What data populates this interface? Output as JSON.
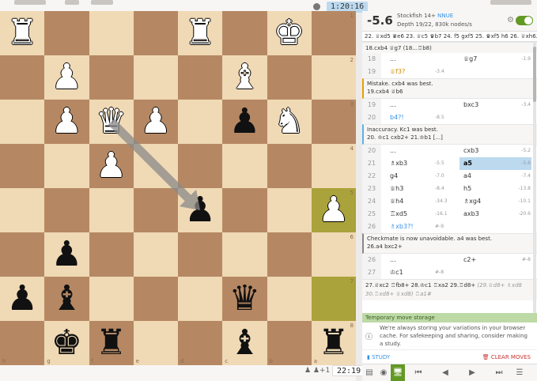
{
  "clocks": {
    "top": "1:20:16",
    "bottom": "22:19"
  },
  "board": {
    "files": [
      "h",
      "g",
      "f",
      "e",
      "d",
      "c",
      "b",
      "a"
    ],
    "ranks": [
      "1",
      "2",
      "3",
      "4",
      "5",
      "6",
      "7",
      "8"
    ],
    "highlight_squares": [
      "a5",
      "a7"
    ],
    "arrow": {
      "from": "f3",
      "to": "d5",
      "color": "#8a8a8a"
    },
    "pieces": [
      {
        "square": "h1",
        "symbol": "♜",
        "side": "white",
        "name": "white-rook"
      },
      {
        "square": "d1",
        "symbol": "♜",
        "side": "white",
        "name": "white-rook"
      },
      {
        "square": "b1",
        "symbol": "♚",
        "side": "white",
        "name": "white-king"
      },
      {
        "square": "g2",
        "symbol": "♟",
        "side": "white",
        "name": "white-pawn"
      },
      {
        "square": "c2",
        "symbol": "♝",
        "side": "white",
        "name": "white-bishop"
      },
      {
        "square": "g3",
        "symbol": "♟",
        "side": "white",
        "name": "white-pawn"
      },
      {
        "square": "f3",
        "symbol": "♛",
        "side": "white",
        "name": "white-queen"
      },
      {
        "square": "e3",
        "symbol": "♟",
        "side": "white",
        "name": "white-pawn"
      },
      {
        "square": "b3",
        "symbol": "♞",
        "side": "white",
        "name": "white-knight"
      },
      {
        "square": "f4",
        "symbol": "♟",
        "side": "white",
        "name": "white-pawn"
      },
      {
        "square": "a5",
        "symbol": "♟",
        "side": "white",
        "name": "white-pawn"
      },
      {
        "square": "c3",
        "symbol": "♟",
        "side": "black",
        "name": "black-pawn"
      },
      {
        "square": "d5",
        "symbol": "♟",
        "side": "black",
        "name": "black-pawn"
      },
      {
        "square": "g6",
        "symbol": "♟",
        "side": "black",
        "name": "black-pawn"
      },
      {
        "square": "h7",
        "symbol": "♟",
        "side": "black",
        "name": "black-pawn"
      },
      {
        "square": "g7",
        "symbol": "♝",
        "side": "black",
        "name": "black-bishop"
      },
      {
        "square": "c7",
        "symbol": "♛",
        "side": "black",
        "name": "black-queen"
      },
      {
        "square": "g8",
        "symbol": "♚",
        "side": "black",
        "name": "black-king"
      },
      {
        "square": "f8",
        "symbol": "♜",
        "side": "black",
        "name": "black-rook"
      },
      {
        "square": "c8",
        "symbol": "♝",
        "side": "black",
        "name": "black-bishop"
      },
      {
        "square": "a8",
        "symbol": "♜",
        "side": "black",
        "name": "black-rook"
      }
    ]
  },
  "below_board": {
    "icons": "♟ ♟+1"
  },
  "engine": {
    "eval": "-5.6",
    "name": "Stockfish 14+",
    "nnue": "NNUE",
    "depth": "Depth 19/22, 830k nodes/s",
    "gear_icon": "⚙",
    "pv": "22. ♕xd5 ♛e6 23. ♕c5 ♛b7 24. f5 gxf5 25. ♛xf5 h6 26. ♕xh6..."
  },
  "moves": {
    "top_variation": "18.cxb4 ♕g7 (18...♖b8)",
    "rows1": [
      {
        "num": "18",
        "white": "...",
        "white_eval": "",
        "black": "♕g7",
        "black_eval": "-1.9",
        "white_class": "",
        "black_class": ""
      },
      {
        "num": "19",
        "white": "♕f3?",
        "white_eval": "-3.4",
        "black": "",
        "black_eval": "",
        "white_class": "orange",
        "black_class": ""
      }
    ],
    "comment1": {
      "title": "Mistake. cxb4 was best.",
      "line": "19.cxb4 ♕b6"
    },
    "rows2": [
      {
        "num": "19",
        "white": "...",
        "white_eval": "",
        "black": "bxc3",
        "black_eval": "-3.4",
        "white_class": "",
        "black_class": ""
      },
      {
        "num": "20",
        "white": "b4?!",
        "white_eval": "-8.5",
        "black": "",
        "black_eval": "",
        "white_class": "blue",
        "black_class": ""
      }
    ],
    "comment2": {
      "title": "Inaccuracy. Kc1 was best.",
      "line": "20. ♔c1 cxb2+ 21.♔b1 [...]"
    },
    "rows3": [
      {
        "num": "20",
        "white": "...",
        "white_eval": "",
        "black": "cxb3",
        "black_eval": "-5.2",
        "white_class": "",
        "black_class": "",
        "current": false
      },
      {
        "num": "21",
        "white": "♗xb3",
        "white_eval": "-5.5",
        "black": "a5",
        "black_eval": "-5.6",
        "white_class": "",
        "black_class": "",
        "current": true
      },
      {
        "num": "22",
        "white": "g4",
        "white_eval": "-7.0",
        "black": "a4",
        "black_eval": "-7.4",
        "white_class": "",
        "black_class": "",
        "current": false
      },
      {
        "num": "23",
        "white": "♕h3",
        "white_eval": "-8.4",
        "black": "h5",
        "black_eval": "-13.8",
        "white_class": "",
        "black_class": "",
        "current": false
      },
      {
        "num": "24",
        "white": "♕h4",
        "white_eval": "-34.3",
        "black": "♗xg4",
        "black_eval": "-10.1",
        "white_class": "",
        "black_class": "",
        "current": false
      },
      {
        "num": "25",
        "white": "♖xd5",
        "white_eval": "-16.1",
        "black": "axb3",
        "black_eval": "-20.6",
        "white_class": "",
        "black_class": "",
        "current": false
      },
      {
        "num": "26",
        "white": "♗xb3?!",
        "white_eval": "#-9",
        "black": "",
        "black_eval": "",
        "white_class": "blue",
        "black_class": "",
        "current": false
      }
    ],
    "comment3": {
      "title": "Checkmate is now unavoidable. a4 was best.",
      "line": "26.a4 bxc2+"
    },
    "rows4": [
      {
        "num": "26",
        "white": "...",
        "white_eval": "",
        "black": "c2+",
        "black_eval": "#-8",
        "white_class": "",
        "black_class": ""
      },
      {
        "num": "27",
        "white": "♔c1",
        "white_eval": "#-8",
        "black": "",
        "black_eval": "",
        "white_class": "",
        "black_class": ""
      }
    ],
    "end_variation_main": "27.♕xc2 ♖fb8+ 28.♔c1 ♖xa2 29.♖d8+",
    "end_variation_dim": "(29.♕d8+ ♗xd8",
    "end_variation_2": "30.♖xd8+ ♕xd8) ♖a1#"
  },
  "tms": {
    "title": "Temporary move storage",
    "body": "We're always storing your variations in your browser cache. For safekeeping and sharing, consider making a study.",
    "study_label": "STUDY",
    "clear_label": "CLEAR MOVES"
  },
  "controls": {
    "icons": [
      "▤",
      "◉",
      "🖥",
      "⏮",
      "◀",
      "▶",
      "⏭",
      "☰"
    ]
  },
  "colors": {
    "light": "#f0d9b5",
    "dark": "#b58863",
    "highlight": "#aaa23a",
    "accent": "#629924",
    "blue": "#3692e7"
  }
}
